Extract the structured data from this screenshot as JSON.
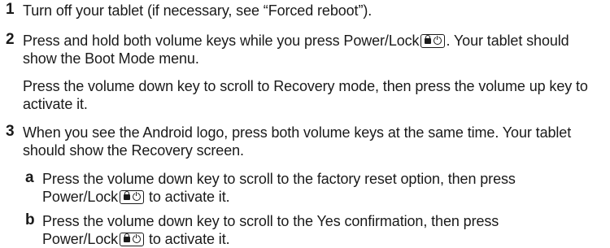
{
  "steps": [
    {
      "number": "1",
      "lines": [
        "Turn off your tablet (if necessary, see “Forced reboot”)."
      ]
    },
    {
      "number": "2",
      "line1_before_icon": "Press and hold both volume keys while you press Power/Lock",
      "line1_after_icon": ". Your tablet should",
      "line2": "show the Boot Mode menu.",
      "para2_line1": "Press the volume down key to scroll to Recovery mode, then press the volume up key to",
      "para2_line2": "activate it."
    },
    {
      "number": "3",
      "line1": "When you see the Android logo, press both volume keys at the same time. Your tablet",
      "line2": "should show the Recovery screen.",
      "substeps": [
        {
          "letter": "a",
          "line1": "Press the volume down key to scroll to the factory reset option, then press",
          "line2_before_icon": "Power/Lock",
          "line2_after_icon": " to activate it."
        },
        {
          "letter": "b",
          "line1": "Press the volume down key to scroll to the Yes confirmation, then press",
          "line2_before_icon": "Power/Lock",
          "line2_after_icon": " to activate it."
        }
      ]
    }
  ],
  "icons": {
    "power_lock_key": "power-lock-key-icon"
  }
}
